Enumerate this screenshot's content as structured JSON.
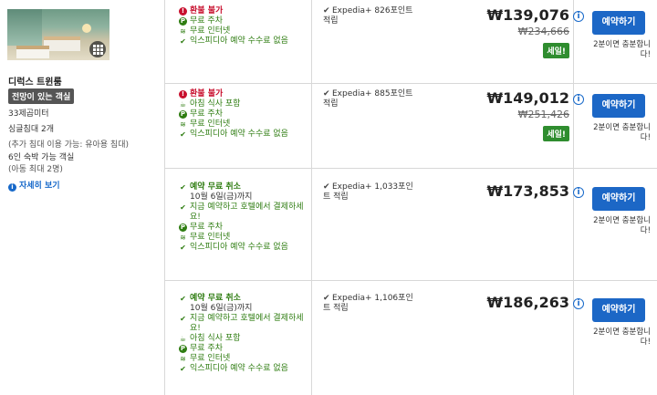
{
  "room": {
    "title": "디럭스 트윈룸",
    "view_badge": "전망이 있는 객실",
    "size": "33제곱미터",
    "bed": "싱글침대 2개",
    "extra_bed": "(추가 침대 이용 가능: 유아용 침대)",
    "capacity": "6인 숙박 가능 객실",
    "children": "(아동 최대 2명)",
    "details_link": "자세히 보기"
  },
  "offers": [
    {
      "features": [
        {
          "icon": "exclamation-icon",
          "text": "환불 불가",
          "style": "red"
        },
        {
          "icon": "parking-icon",
          "text": "무료 주차",
          "style": ""
        },
        {
          "icon": "wifi-icon",
          "text": "무료 인터넷",
          "style": ""
        },
        {
          "icon": "check-icon",
          "text": "익스피디아 예약 수수료 없음",
          "style": ""
        }
      ],
      "points": "Expedia+ 826포인트 적립",
      "price": "₩139,076",
      "old_price": "₩234,666",
      "sale": "세일!",
      "book_label": "예약하기",
      "book_note": "2분이면 충분합니다!"
    },
    {
      "features": [
        {
          "icon": "exclamation-icon",
          "text": "환불 불가",
          "style": "red"
        },
        {
          "icon": "coffee-cup-icon",
          "text": "아침 식사 포함",
          "style": ""
        },
        {
          "icon": "parking-icon",
          "text": "무료 주차",
          "style": ""
        },
        {
          "icon": "wifi-icon",
          "text": "무료 인터넷",
          "style": ""
        },
        {
          "icon": "check-icon",
          "text": "익스피디아 예약 수수료 없음",
          "style": ""
        }
      ],
      "points": "Expedia+ 885포인트 적립",
      "price": "₩149,012",
      "old_price": "₩251,426",
      "sale": "세일!",
      "book_label": "예약하기",
      "book_note": "2분이면 충분합니다!"
    },
    {
      "features": [
        {
          "icon": "check-icon",
          "text": "예약 무료 취소",
          "style": "bold"
        },
        {
          "icon": "",
          "text": "10월 6일(금)까지",
          "style": "sub"
        },
        {
          "icon": "check-icon",
          "text": "지금 예약하고 호텔에서 결제하세요!",
          "style": ""
        },
        {
          "icon": "parking-icon",
          "text": "무료 주차",
          "style": ""
        },
        {
          "icon": "wifi-icon",
          "text": "무료 인터넷",
          "style": ""
        },
        {
          "icon": "check-icon",
          "text": "익스피디아 예약 수수료 없음",
          "style": ""
        }
      ],
      "points": "Expedia+ 1,033포인트 적립",
      "price": "₩173,853",
      "old_price": "",
      "sale": "",
      "book_label": "예약하기",
      "book_note": "2분이면 충분합니다!"
    },
    {
      "features": [
        {
          "icon": "check-icon",
          "text": "예약 무료 취소",
          "style": "bold"
        },
        {
          "icon": "",
          "text": "10월 6일(금)까지",
          "style": "sub"
        },
        {
          "icon": "check-icon",
          "text": "지금 예약하고 호텔에서 결제하세요!",
          "style": ""
        },
        {
          "icon": "coffee-cup-icon",
          "text": "아침 식사 포함",
          "style": ""
        },
        {
          "icon": "parking-icon",
          "text": "무료 주차",
          "style": ""
        },
        {
          "icon": "wifi-icon",
          "text": "무료 인터넷",
          "style": ""
        },
        {
          "icon": "check-icon",
          "text": "익스피디아 예약 수수료 없음",
          "style": ""
        }
      ],
      "points": "Expedia+ 1,106포인트 적립",
      "price": "₩186,263",
      "old_price": "",
      "sale": "",
      "book_label": "예약하기",
      "book_note": "2분이면 충분합니다!"
    }
  ],
  "colors": {
    "accent_blue": "#1c67c6",
    "sale_green": "#2f8d2f",
    "feature_green": "#2f7d12",
    "refund_red": "#c8102e"
  }
}
